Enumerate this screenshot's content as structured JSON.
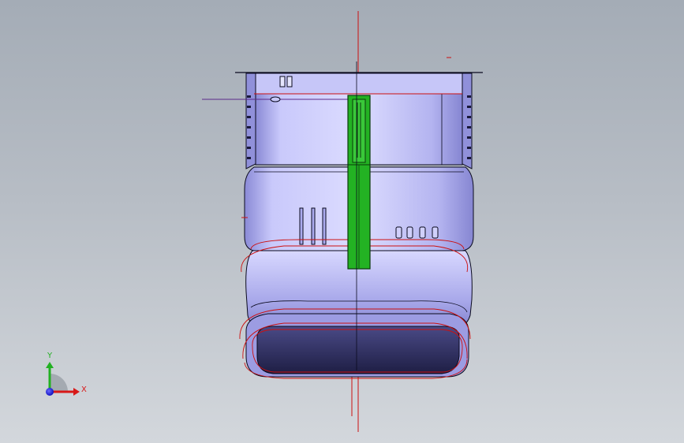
{
  "viewport": {
    "background_top": "#a4acb6",
    "background_bottom": "#d3d7dc"
  },
  "model": {
    "body_color": "#b9b9f4",
    "body_shade": "#8c8ce0",
    "edge_color": "#0a0a1e",
    "handle_color": "#2c2c5a",
    "sketch_color": "#cc1010",
    "selection_color": "#23b223",
    "thread_color": "#5a2a8a"
  },
  "triad": {
    "x_label": "X",
    "y_label": "Y",
    "x_color": "#d81818",
    "y_color": "#22b022",
    "z_color": "#1818d8"
  }
}
